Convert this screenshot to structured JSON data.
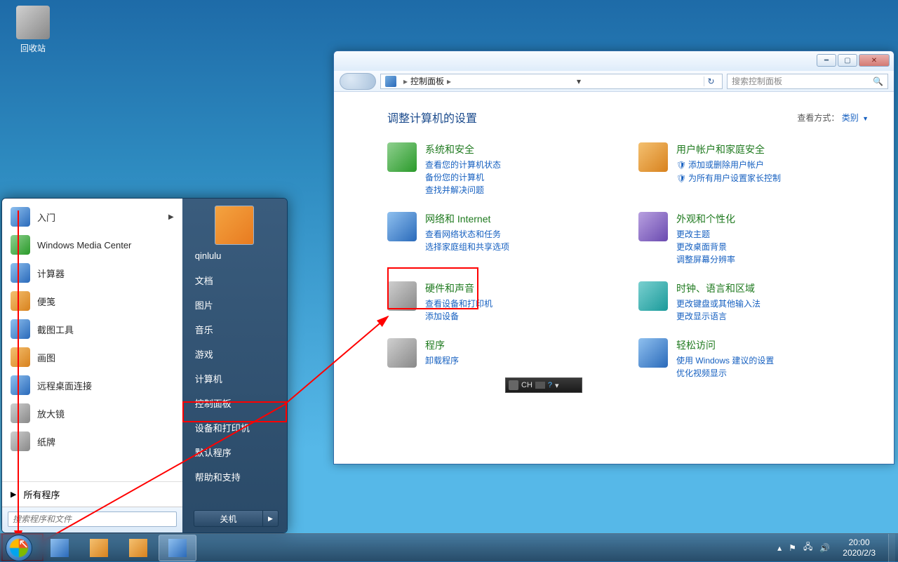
{
  "desktop": {
    "recycle_label": "回收站"
  },
  "control_panel": {
    "breadcrumb_root": "控制面板",
    "search_placeholder": "搜索控制面板",
    "heading": "调整计算机的设置",
    "viewby_label": "查看方式：",
    "viewby_value": "类别",
    "items": [
      {
        "title": "系统和安全",
        "subs": [
          "查看您的计算机状态",
          "备份您的计算机",
          "查找并解决问题"
        ],
        "icon": "ic-green"
      },
      {
        "title": "用户帐户和家庭安全",
        "subs": [
          "添加或删除用户帐户",
          "为所有用户设置家长控制"
        ],
        "icon": "ic-orange",
        "shield": true
      },
      {
        "title": "网络和 Internet",
        "subs": [
          "查看网络状态和任务",
          "选择家庭组和共享选项"
        ],
        "icon": "ic-blue"
      },
      {
        "title": "外观和个性化",
        "subs": [
          "更改主题",
          "更改桌面背景",
          "调整屏幕分辨率"
        ],
        "icon": "ic-purple"
      },
      {
        "title": "硬件和声音",
        "subs": [
          "查看设备和打印机",
          "添加设备"
        ],
        "icon": "ic-gray"
      },
      {
        "title": "时钟、语言和区域",
        "subs": [
          "更改键盘或其他输入法",
          "更改显示语言"
        ],
        "icon": "ic-teal"
      },
      {
        "title": "程序",
        "subs": [
          "卸载程序"
        ],
        "icon": "ic-gray"
      },
      {
        "title": "轻松访问",
        "subs": [
          "使用 Windows 建议的设置",
          "优化视频显示"
        ],
        "icon": "ic-blue"
      }
    ]
  },
  "ime": {
    "label": "CH"
  },
  "start_menu": {
    "user": "qinlulu",
    "left_items": [
      {
        "label": "入门",
        "icon": "ic-blue",
        "arrow": true
      },
      {
        "label": "Windows Media Center",
        "icon": "ic-green"
      },
      {
        "label": "计算器",
        "icon": "ic-blue"
      },
      {
        "label": "便笺",
        "icon": "ic-orange"
      },
      {
        "label": "截图工具",
        "icon": "ic-blue"
      },
      {
        "label": "画图",
        "icon": "ic-orange"
      },
      {
        "label": "远程桌面连接",
        "icon": "ic-blue"
      },
      {
        "label": "放大镜",
        "icon": "ic-gray"
      },
      {
        "label": "纸牌",
        "icon": "ic-gray"
      }
    ],
    "all_programs": "所有程序",
    "search_placeholder": "搜索程序和文件",
    "right_items": [
      "文档",
      "图片",
      "音乐",
      "游戏",
      "计算机",
      "控制面板",
      "设备和打印机",
      "默认程序",
      "帮助和支持"
    ],
    "shutdown": "关机"
  },
  "tray": {
    "time": "20:00",
    "date": "2020/2/3"
  }
}
